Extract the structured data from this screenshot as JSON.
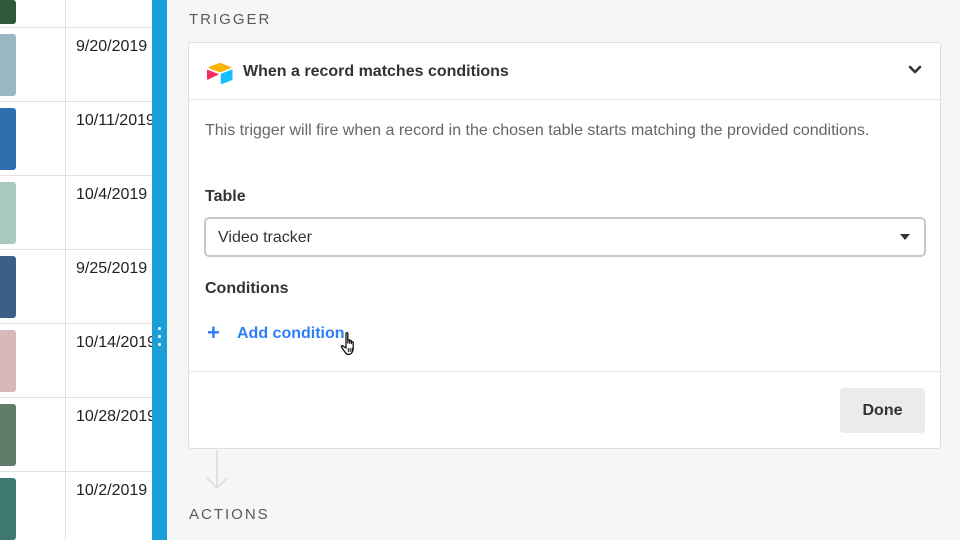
{
  "table": {
    "rows": [
      {
        "date": "",
        "thumb_color": "#2f5a3a"
      },
      {
        "date": "9/20/2019",
        "thumb_color": "#9bb7c4"
      },
      {
        "date": "10/11/2019",
        "thumb_color": "#2e6fb0"
      },
      {
        "date": "10/4/2019",
        "thumb_color": "#a9c8c0"
      },
      {
        "date": "9/25/2019",
        "thumb_color": "#3b5f86"
      },
      {
        "date": "10/14/2019",
        "thumb_color": "#d8b9b9"
      },
      {
        "date": "10/28/2019",
        "thumb_color": "#5f7d6a"
      },
      {
        "date": "10/2/2019",
        "thumb_color": "#3e7a72"
      }
    ]
  },
  "trigger_section": {
    "label": "TRIGGER",
    "card_title": "When a record matches conditions",
    "description": "This trigger will fire when a record in the chosen table starts matching the provided conditions.",
    "table_label": "Table",
    "table_value": "Video tracker",
    "conditions_label": "Conditions",
    "add_condition_label": "Add condition",
    "add_condition_icon": "+",
    "done_label": "Done"
  },
  "actions_section": {
    "label": "ACTIONS"
  },
  "colors": {
    "divider": "#1a9fd9",
    "accent": "#2d7ff9"
  }
}
